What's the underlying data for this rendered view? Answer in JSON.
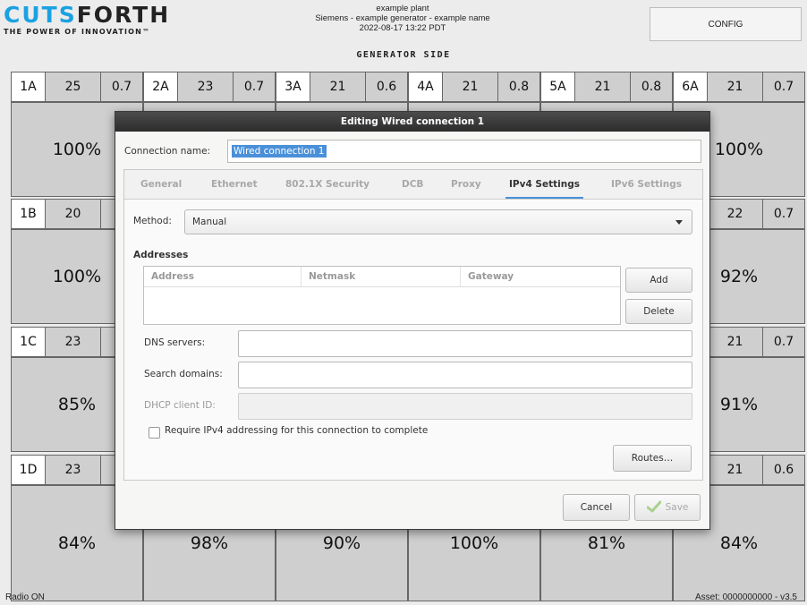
{
  "header": {
    "logo_main_1": "CUTS",
    "logo_main_2": "FORTH",
    "logo_tagline": "THE POWER OF INNOVATION™",
    "plant": "example plant",
    "generator": "Siemens - example generator - example name",
    "datetime": "2022-08-17 13:22 PDT",
    "config_label": "CONFIG",
    "side_title": "GENERATOR SIDE"
  },
  "grid": {
    "columns": [
      "1",
      "2",
      "3",
      "4",
      "5",
      "6"
    ],
    "rows": [
      {
        "row": "A",
        "cells": [
          {
            "label": "1A",
            "value": "25",
            "factor": "0.7",
            "percent": "100%"
          },
          {
            "label": "2A",
            "value": "23",
            "factor": "0.7",
            "percent": ""
          },
          {
            "label": "3A",
            "value": "21",
            "factor": "0.6",
            "percent": ""
          },
          {
            "label": "4A",
            "value": "21",
            "factor": "0.8",
            "percent": ""
          },
          {
            "label": "5A",
            "value": "21",
            "factor": "0.8",
            "percent": ""
          },
          {
            "label": "6A",
            "value": "21",
            "factor": "0.7",
            "percent": "100%"
          }
        ]
      },
      {
        "row": "B",
        "cells": [
          {
            "label": "1B",
            "value": "20",
            "factor": "",
            "percent": "100%"
          },
          {
            "label": "",
            "value": "",
            "factor": "",
            "percent": ""
          },
          {
            "label": "",
            "value": "",
            "factor": "",
            "percent": ""
          },
          {
            "label": "",
            "value": "",
            "factor": "",
            "percent": ""
          },
          {
            "label": "",
            "value": "",
            "factor": "",
            "percent": ""
          },
          {
            "label": "",
            "value": "22",
            "factor": "0.7",
            "percent": "92%"
          }
        ]
      },
      {
        "row": "C",
        "cells": [
          {
            "label": "1C",
            "value": "23",
            "factor": "",
            "percent": "85%"
          },
          {
            "label": "",
            "value": "",
            "factor": "",
            "percent": ""
          },
          {
            "label": "",
            "value": "",
            "factor": "",
            "percent": ""
          },
          {
            "label": "",
            "value": "",
            "factor": "",
            "percent": ""
          },
          {
            "label": "",
            "value": "",
            "factor": "",
            "percent": ""
          },
          {
            "label": "",
            "value": "21",
            "factor": "0.7",
            "percent": "91%"
          }
        ]
      },
      {
        "row": "D",
        "cells": [
          {
            "label": "1D",
            "value": "23",
            "factor": "",
            "percent": "84%"
          },
          {
            "label": "",
            "value": "",
            "factor": "",
            "percent": "98%"
          },
          {
            "label": "",
            "value": "",
            "factor": "",
            "percent": "90%"
          },
          {
            "label": "",
            "value": "",
            "factor": "",
            "percent": "100%"
          },
          {
            "label": "",
            "value": "",
            "factor": "",
            "percent": "81%"
          },
          {
            "label": "",
            "value": "21",
            "factor": "0.6",
            "percent": "84%"
          }
        ]
      }
    ]
  },
  "footer": {
    "left": "Radio ON",
    "right": "Asset: 0000000000 - v3.5"
  },
  "dialog": {
    "title": "Editing Wired connection 1",
    "connection_name_label": "Connection name:",
    "connection_name_value": "Wired connection 1",
    "tabs": [
      "General",
      "Ethernet",
      "802.1X Security",
      "DCB",
      "Proxy",
      "IPv4 Settings",
      "IPv6 Settings"
    ],
    "active_tab": "IPv4 Settings",
    "method_label": "Method:",
    "method_value": "Manual",
    "addresses_title": "Addresses",
    "addr_columns": [
      "Address",
      "Netmask",
      "Gateway"
    ],
    "add_label": "Add",
    "delete_label": "Delete",
    "dns_label": "DNS servers:",
    "search_label": "Search domains:",
    "dhcp_label": "DHCP client ID:",
    "require_label": "Require IPv4 addressing for this connection to complete",
    "routes_label": "Routes…",
    "cancel_label": "Cancel",
    "save_label": "Save"
  },
  "colors": {
    "brand_blue": "#1ba1e2",
    "selection": "#4a90d9",
    "cell_gray": "#cfcfcf"
  }
}
